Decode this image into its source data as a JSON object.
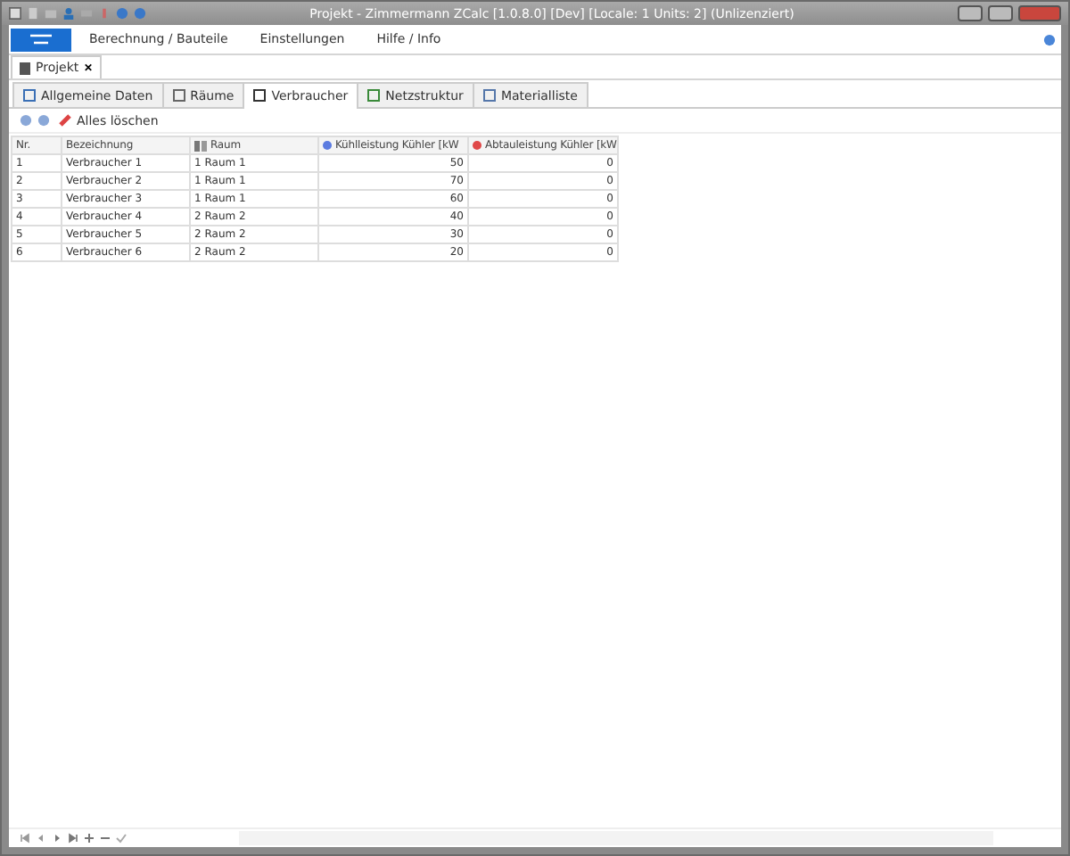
{
  "window": {
    "title": "Projekt - Zimmermann ZCalc [1.0.8.0] [Dev] [Locale: 1 Units: 2] (Unlizenziert)"
  },
  "menu": [
    "Berechnung / Bauteile",
    "Einstellungen",
    "Hilfe / Info"
  ],
  "document_tabs": [
    {
      "label": "Projekt",
      "close": "✕",
      "selected": true
    }
  ],
  "tabs": [
    {
      "label": "Allgemeine Daten",
      "selected": false
    },
    {
      "label": "Räume",
      "selected": false
    },
    {
      "label": "Verbraucher",
      "selected": true
    },
    {
      "label": "Netzstruktur",
      "selected": false
    },
    {
      "label": "Materialliste",
      "selected": false
    }
  ],
  "toolbar": {
    "clear_all": "Alles löschen"
  },
  "table": {
    "columns": [
      {
        "label": "Nr.",
        "kind": "plain"
      },
      {
        "label": "Bezeichnung",
        "kind": "plain"
      },
      {
        "label": "Raum",
        "kind": "room"
      },
      {
        "label": "Kühlleistung Kühler [kW",
        "kind": "dot",
        "color": "#5b7be0"
      },
      {
        "label": "Abtauleistung Kühler [kW",
        "kind": "dot",
        "color": "#e04848"
      }
    ],
    "rows": [
      [
        "1",
        "Verbraucher 1",
        "1 Raum 1",
        "50",
        "0"
      ],
      [
        "2",
        "Verbraucher 2",
        "1 Raum 1",
        "70",
        "0"
      ],
      [
        "3",
        "Verbraucher 3",
        "1 Raum 1",
        "60",
        "0"
      ],
      [
        "4",
        "Verbraucher 4",
        "2 Raum 2",
        "40",
        "0"
      ],
      [
        "5",
        "Verbraucher 5",
        "2 Raum 2",
        "30",
        "0"
      ],
      [
        "6",
        "Verbraucher 6",
        "2 Raum 2",
        "20",
        "0"
      ]
    ]
  }
}
